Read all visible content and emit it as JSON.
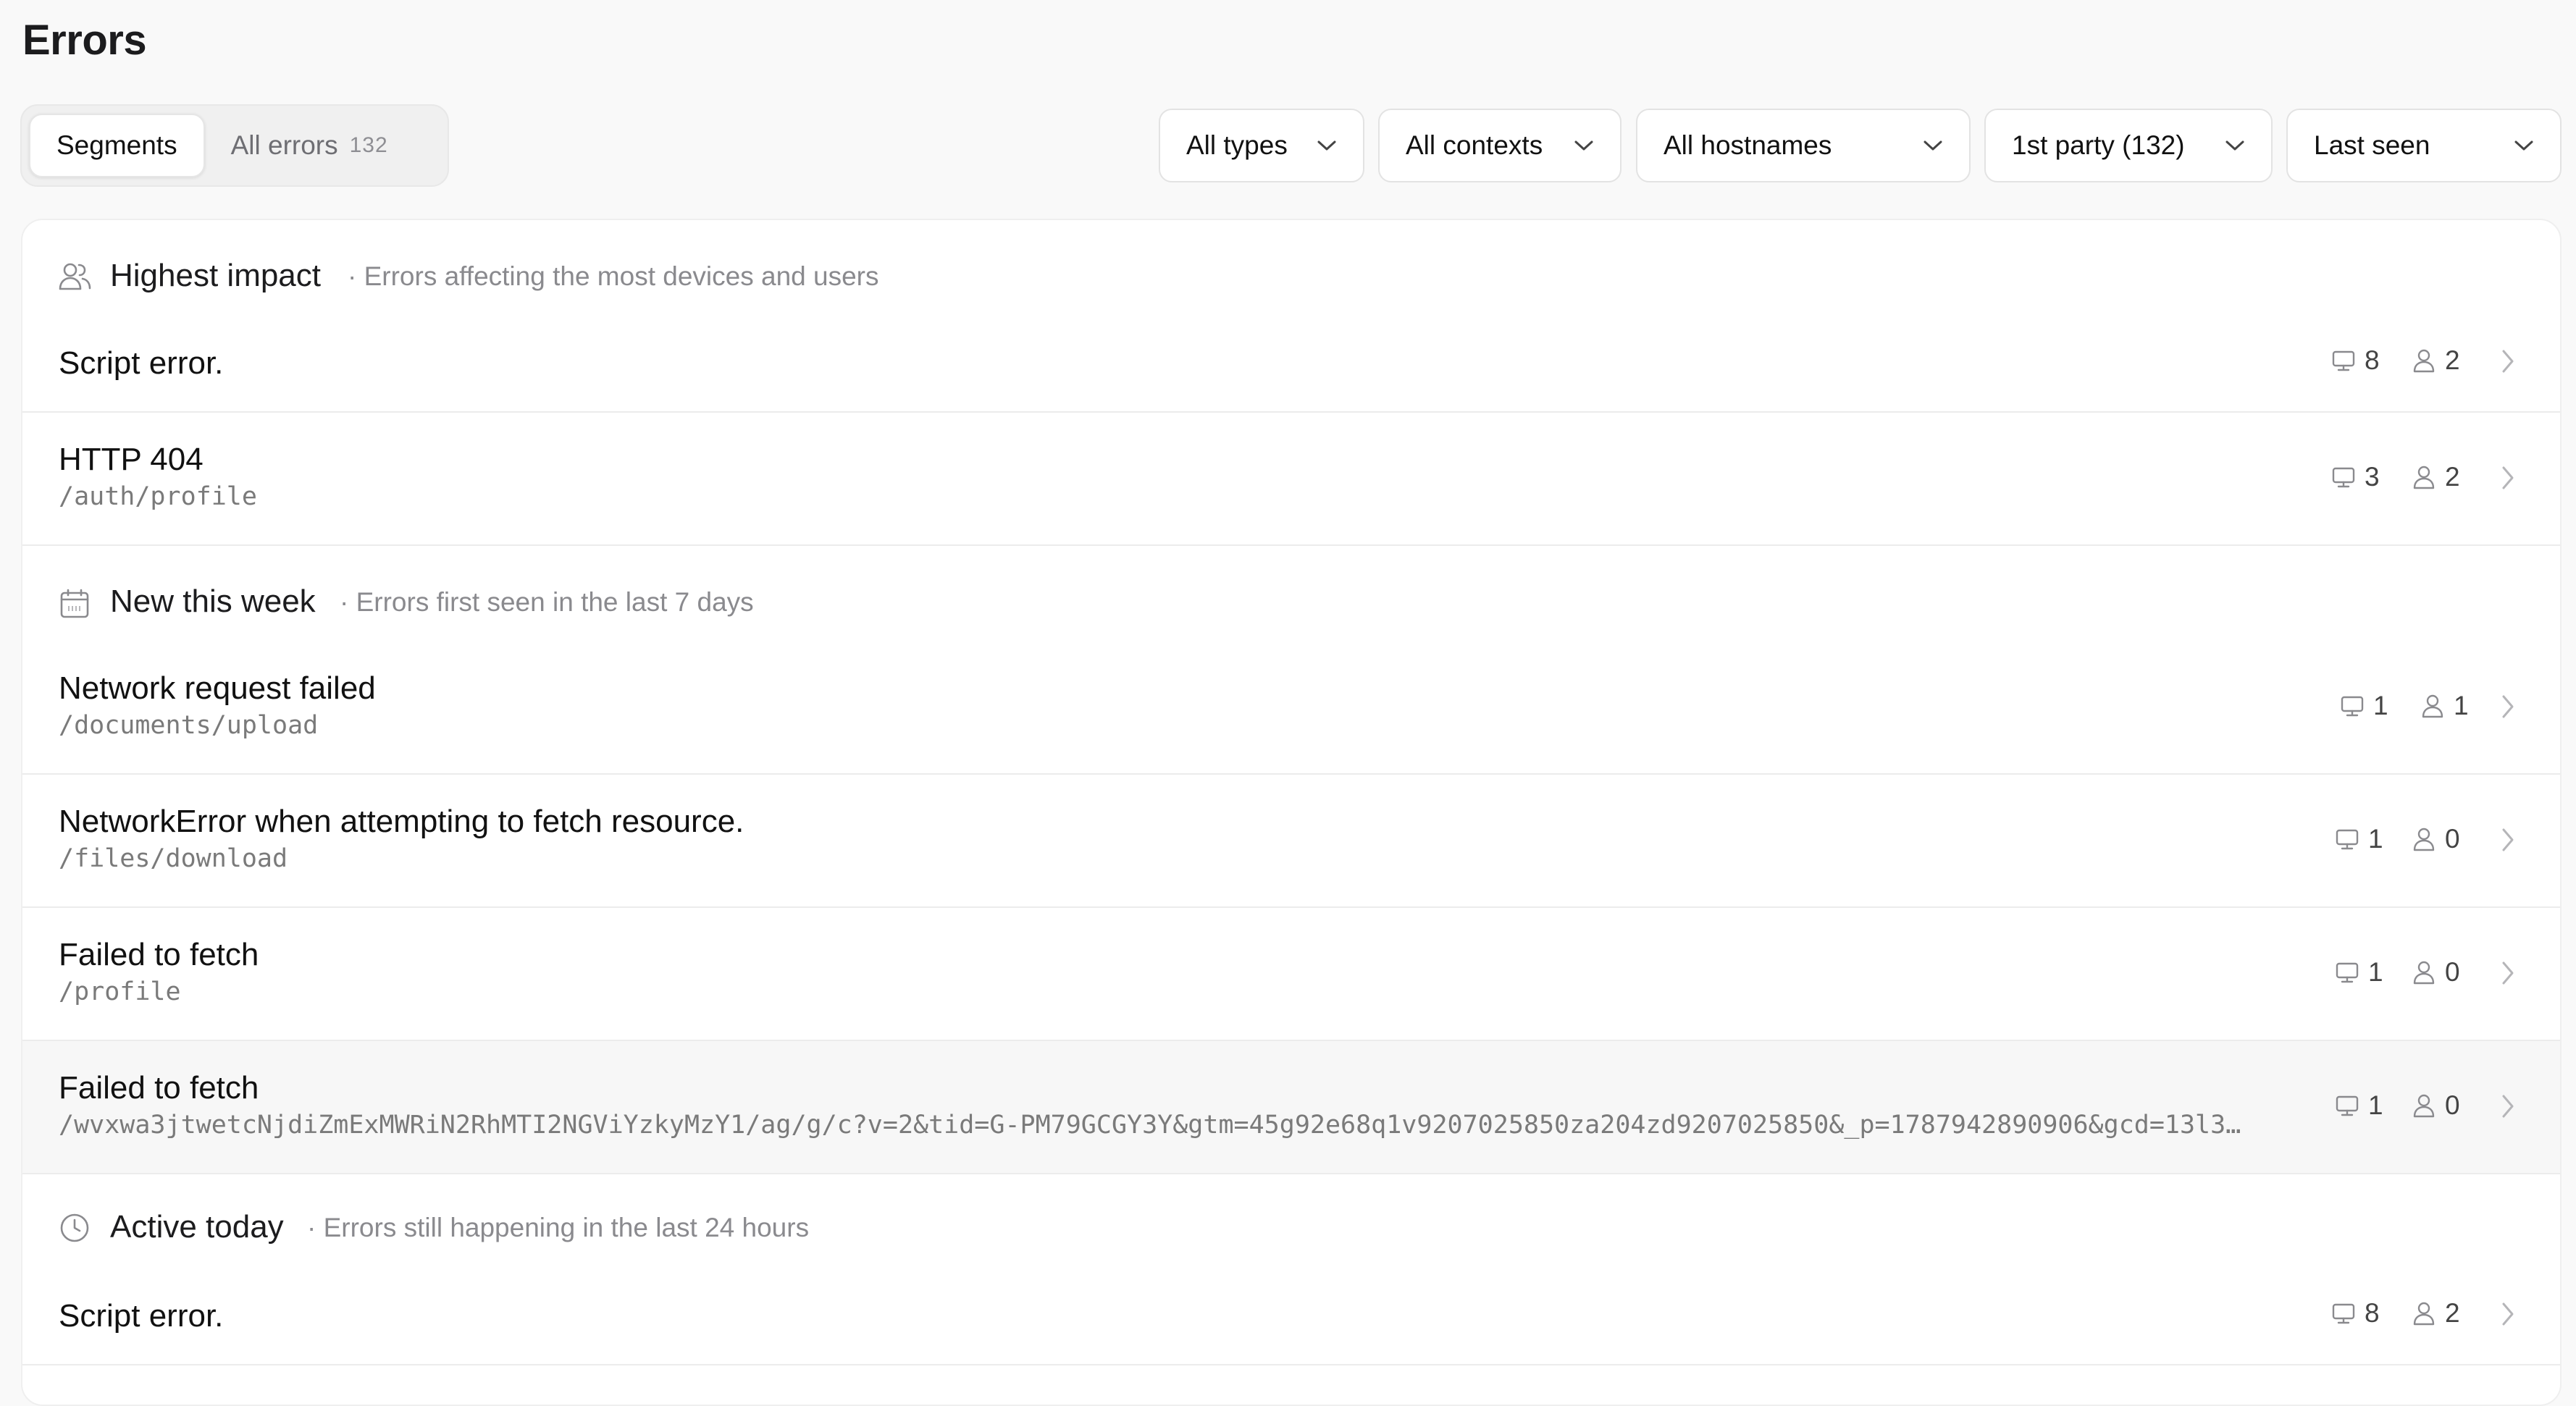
{
  "page": {
    "title": "Errors"
  },
  "segments": {
    "tabs": [
      {
        "label": "Segments",
        "active": true
      },
      {
        "label": "All errors",
        "count": "132",
        "active": false
      }
    ]
  },
  "filters": [
    {
      "label": "All types"
    },
    {
      "label": "All contexts"
    },
    {
      "label": "All hostnames"
    },
    {
      "label": "1st party (132)"
    },
    {
      "label": "Last seen"
    }
  ],
  "sections": [
    {
      "icon": "users-icon",
      "title": "Highest impact",
      "subtitle": "· Errors affecting the most devices and users",
      "rows": [
        {
          "title": "Script error.",
          "path": "",
          "devices": "8",
          "users": "2"
        },
        {
          "title": "HTTP 404",
          "path": "/auth/profile",
          "devices": "3",
          "users": "2"
        }
      ]
    },
    {
      "icon": "calendar-icon",
      "title": "New this week",
      "subtitle": "· Errors first seen in the last 7 days",
      "rows": [
        {
          "title": "Network request failed",
          "path": "/documents/upload",
          "devices": "1",
          "users": "1"
        },
        {
          "title": "NetworkError when attempting to fetch resource.",
          "path": "/files/download",
          "devices": "1",
          "users": "0"
        },
        {
          "title": "Failed to fetch",
          "path": "/profile",
          "devices": "1",
          "users": "0"
        },
        {
          "title": "Failed to fetch",
          "path": "/wvxwa3jtwetcNjdiZmExMWRiN2RhMTI2NGViYzkyMzY1/ag/g/c?v=2&tid=G-PM79GCGY3Y&gtm=45g92e68q1v9207025850za204zd9207025850&_p=1787942890906&gcd=13l3…",
          "devices": "1",
          "users": "0"
        }
      ]
    },
    {
      "icon": "clock-icon",
      "title": "Active today",
      "subtitle": "· Errors still happening in the last 24 hours",
      "rows": [
        {
          "title": "Script error.",
          "path": "",
          "devices": "8",
          "users": "2"
        }
      ]
    }
  ],
  "colors": {
    "border": "#ececec",
    "muted": "#8a8a8e",
    "hover_row": "#f7f7f7"
  }
}
